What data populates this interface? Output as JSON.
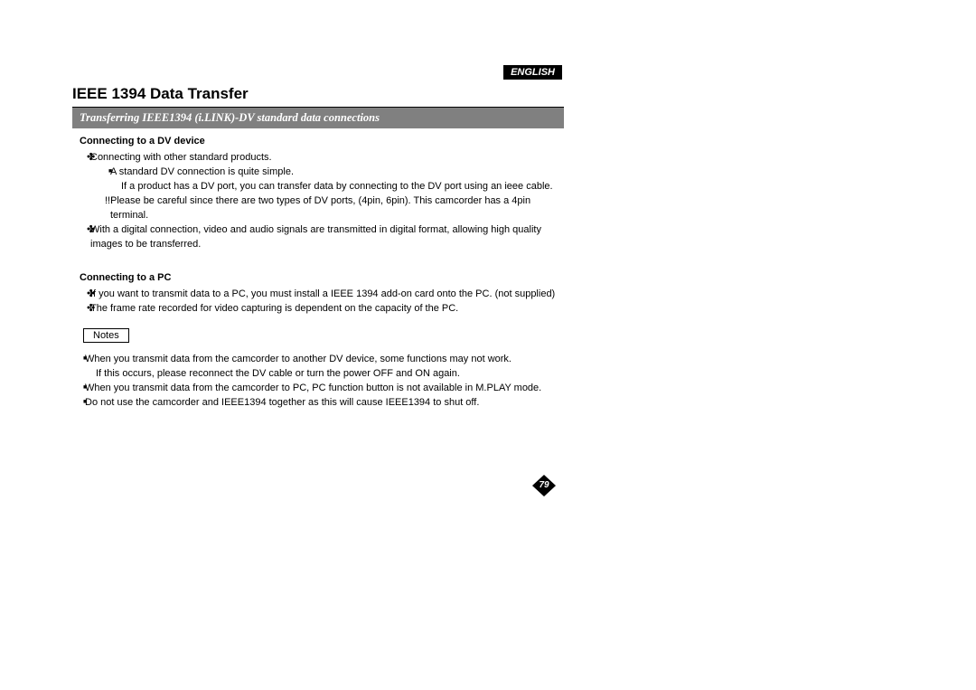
{
  "language_tab": "ENGLISH",
  "title": "IEEE 1394 Data Transfer",
  "subtitle": "Transferring IEEE1394 (i.LINK)-DV standard data connections",
  "section_dv": {
    "heading": "Connecting to a DV device",
    "items": [
      "Connecting with other standard products.",
      "A standard DV connection is quite simple.",
      "If a product has a DV port, you can transfer data by connecting to the DV port using an ieee cable.",
      "Please be careful since there are two types of DV ports, (4pin, 6pin). This camcorder has a 4pin terminal.",
      "With a digital connection, video and audio signals are transmitted in digital format, allowing high quality images to be transferred."
    ]
  },
  "section_pc": {
    "heading": "Connecting to a PC",
    "items": [
      "If you want to transmit data to a PC, you must install a IEEE 1394 add-on card onto the PC. (not supplied)",
      "The frame rate recorded for video capturing is dependent on the capacity of the PC."
    ]
  },
  "notes_label": "Notes",
  "notes": [
    "When you transmit data from the camcorder to another DV device, some functions may not work.",
    "If this occurs, please reconnect the DV cable or turn the power OFF and ON again.",
    "When you transmit data from the camcorder to PC, PC function button is not available in M.PLAY mode.",
    "Do not use the camcorder and IEEE1394 together as this will cause IEEE1394 to shut off."
  ],
  "page_number": "79"
}
